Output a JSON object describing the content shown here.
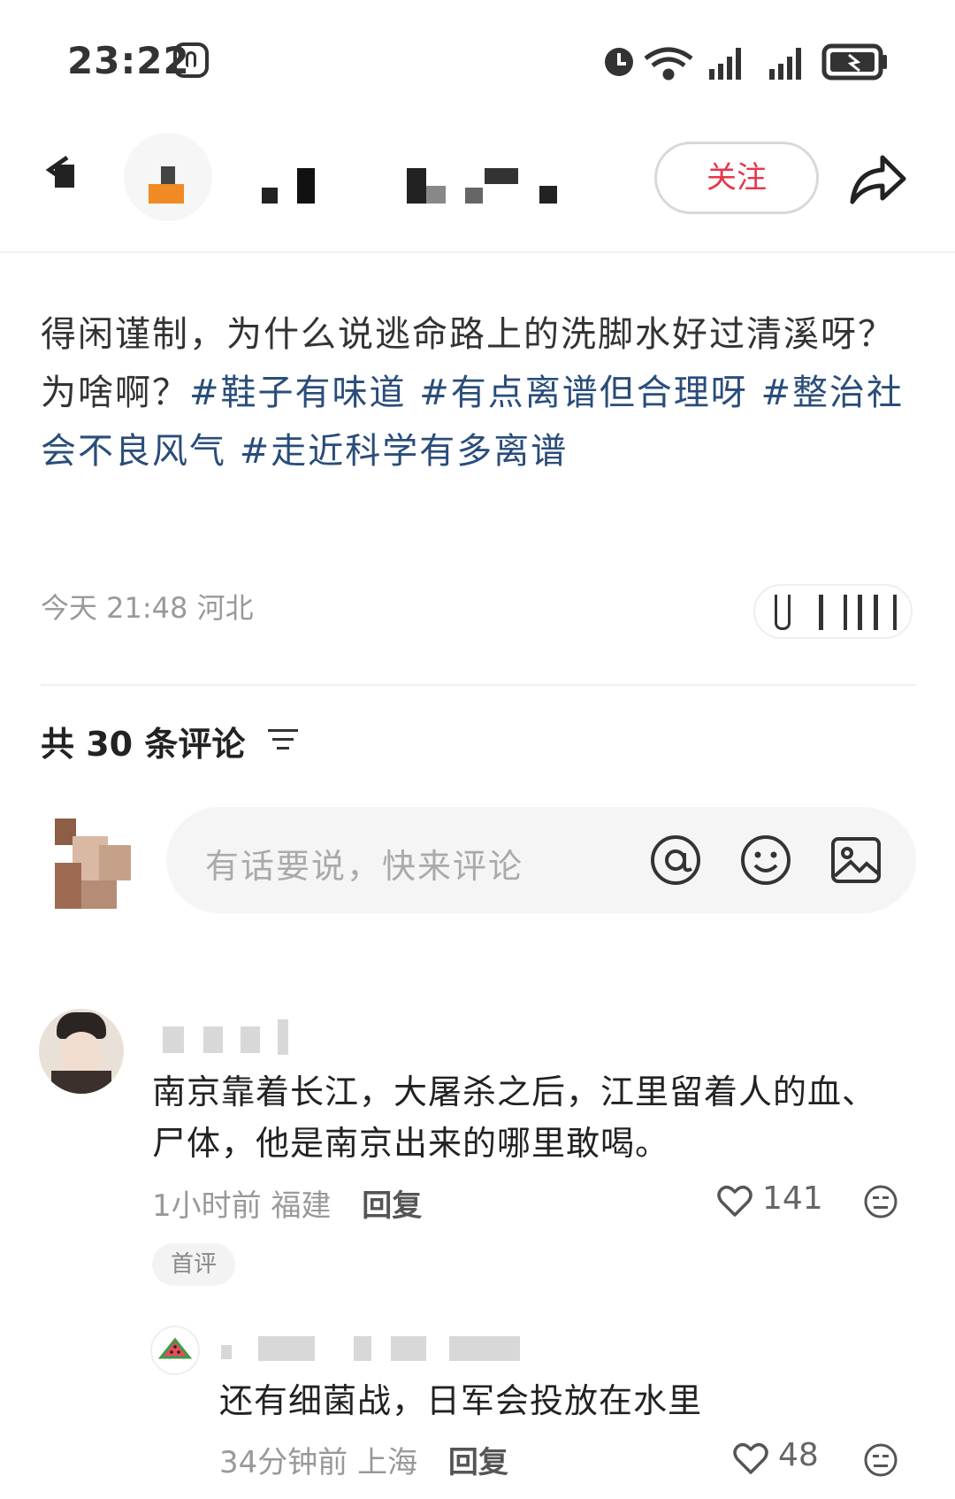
{
  "status": {
    "time": "23:22"
  },
  "header": {
    "follow_label": "关注"
  },
  "post": {
    "text_plain": "得闲谨制，为什么说逃命路上的洗脚水好过清溪呀？",
    "text_line2": "为啥啊？",
    "tags": [
      "#鞋子有味道",
      "#有点离谱但合理呀",
      "#整治社会不良风气",
      "#走近科学有多离谱"
    ],
    "time": "今天 21:48",
    "location": "河北"
  },
  "comments_header": {
    "title": "共 30 条评论"
  },
  "input": {
    "placeholder": "有话要说，快来评论"
  },
  "comments": [
    {
      "text": "南京靠着长江，大屠杀之后，江里留着人的血、尸体，他是南京出来的哪里敢喝。",
      "time": "1小时前",
      "location": "福建",
      "reply_label": "回复",
      "likes": "141",
      "badge": "首评",
      "replies": [
        {
          "text": "还有细菌战，日军会投放在水里",
          "time": "34分钟前",
          "location": "上海",
          "reply_label": "回复",
          "likes": "48"
        }
      ]
    }
  ],
  "colors": {
    "follow": "#e8364a",
    "tag": "#2a4d7a"
  }
}
